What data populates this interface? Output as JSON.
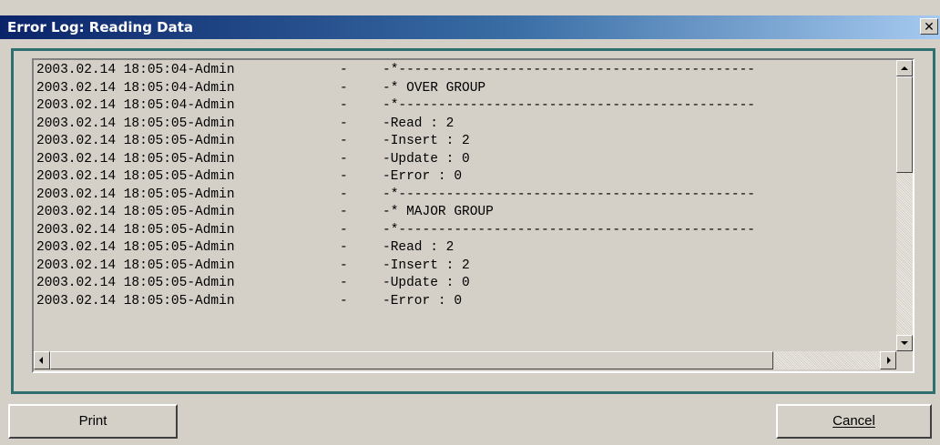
{
  "window": {
    "title": "Error Log: Reading Data",
    "close_label": "✕"
  },
  "log": {
    "rows": [
      {
        "timestamp": "2003.02.14 18:05:04-Admin",
        "sep": "-",
        "message": "-*---------------------------------------------"
      },
      {
        "timestamp": "2003.02.14 18:05:04-Admin",
        "sep": "-",
        "message": "-* OVER GROUP"
      },
      {
        "timestamp": "2003.02.14 18:05:04-Admin",
        "sep": "-",
        "message": "-*---------------------------------------------"
      },
      {
        "timestamp": "2003.02.14 18:05:05-Admin",
        "sep": "-",
        "message": "-Read : 2"
      },
      {
        "timestamp": "2003.02.14 18:05:05-Admin",
        "sep": "-",
        "message": "-Insert : 2"
      },
      {
        "timestamp": "2003.02.14 18:05:05-Admin",
        "sep": "-",
        "message": "-Update : 0"
      },
      {
        "timestamp": "2003.02.14 18:05:05-Admin",
        "sep": "-",
        "message": "-Error : 0"
      },
      {
        "timestamp": "2003.02.14 18:05:05-Admin",
        "sep": "-",
        "message": "-*---------------------------------------------"
      },
      {
        "timestamp": "2003.02.14 18:05:05-Admin",
        "sep": "-",
        "message": "-* MAJOR GROUP"
      },
      {
        "timestamp": "2003.02.14 18:05:05-Admin",
        "sep": "-",
        "message": "-*---------------------------------------------"
      },
      {
        "timestamp": "2003.02.14 18:05:05-Admin",
        "sep": "-",
        "message": "-Read : 2"
      },
      {
        "timestamp": "2003.02.14 18:05:05-Admin",
        "sep": "-",
        "message": "-Insert : 2"
      },
      {
        "timestamp": "2003.02.14 18:05:05-Admin",
        "sep": "-",
        "message": "-Update : 0"
      },
      {
        "timestamp": "2003.02.14 18:05:05-Admin",
        "sep": "-",
        "message": "-Error : 0"
      }
    ]
  },
  "buttons": {
    "print_label": "Print",
    "cancel_label": "Cancel"
  },
  "icons": {
    "close": "close-icon",
    "scroll_up": "arrow-up-icon",
    "scroll_down": "arrow-down-icon",
    "scroll_left": "arrow-left-icon",
    "scroll_right": "arrow-right-icon"
  },
  "colors": {
    "title_start": "#0a246a",
    "title_end": "#a6caf0",
    "frame": "#2f6f6f",
    "face": "#d4d0c8"
  }
}
